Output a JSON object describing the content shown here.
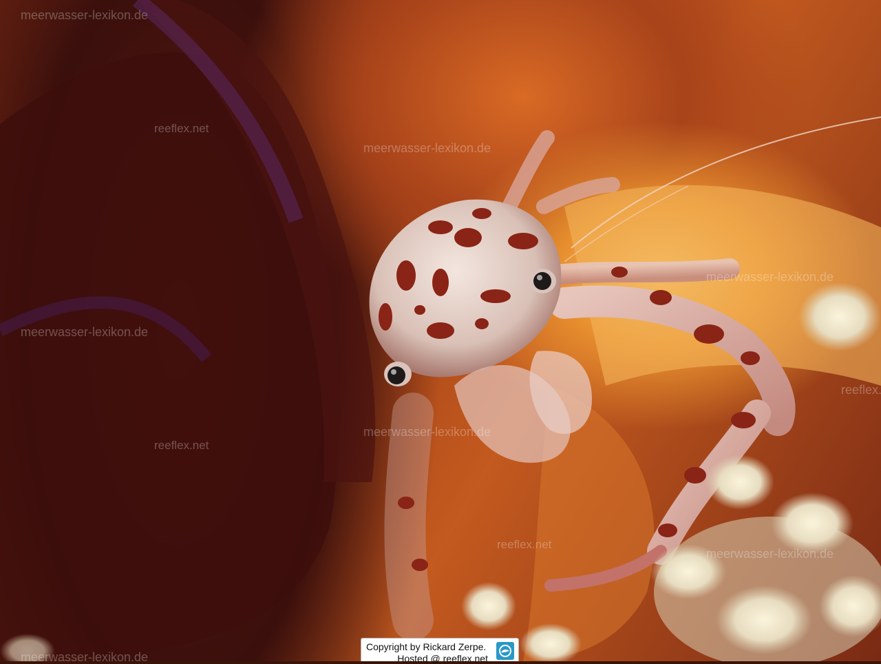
{
  "image": {
    "subject": "spotted porcelain crab on a sea pen"
  },
  "watermarks": {
    "meerwasser": "meerwasser-lexikon.de",
    "reeflex": "reeflex.net"
  },
  "credit": {
    "copyright": "Copyright by Rickard Zerpe.",
    "hosted": "Hosted @ reeflex.net",
    "logo_icon": "reeflex-logo-icon"
  },
  "colors": {
    "background_dark": "#3a1408",
    "orange": "#e8902f",
    "spot": "#8a2416",
    "shell": "#e9d8d0"
  }
}
